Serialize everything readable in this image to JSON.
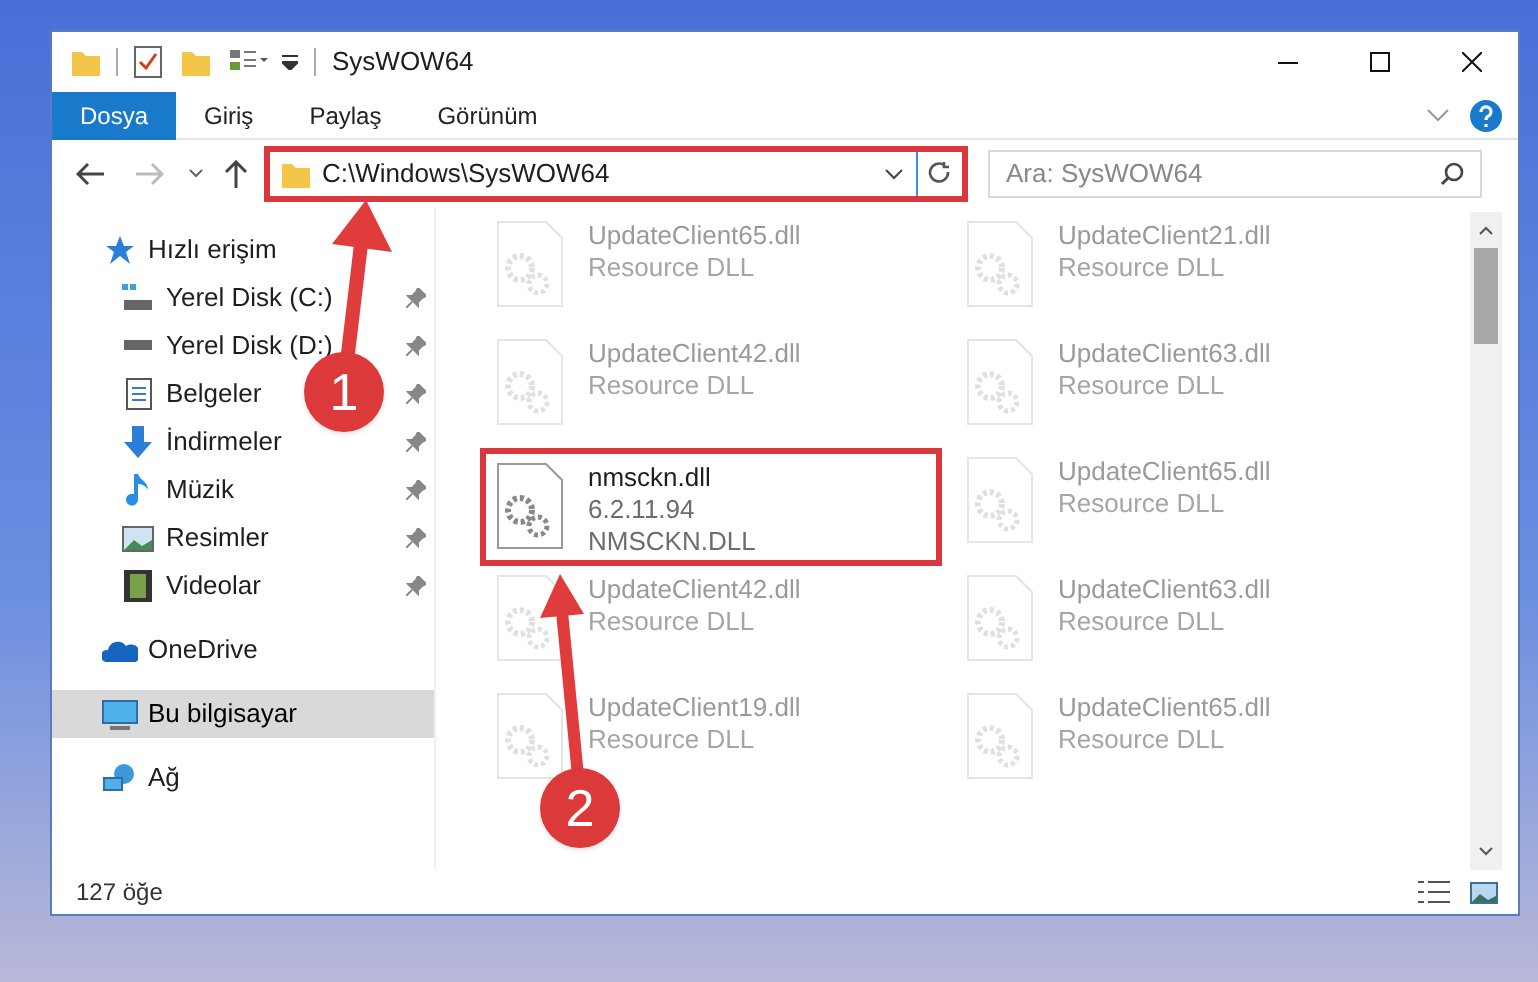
{
  "window": {
    "title": "SysWOW64"
  },
  "ribbon_tabs": [
    {
      "label": "Dosya",
      "selected": true
    },
    {
      "label": "Giriş",
      "selected": false
    },
    {
      "label": "Paylaş",
      "selected": false
    },
    {
      "label": "Görünüm",
      "selected": false
    }
  ],
  "address": {
    "path": "C:\\Windows\\SysWOW64",
    "highlighted": true
  },
  "search": {
    "placeholder": "Ara: SysWOW64"
  },
  "sidebar": {
    "items": [
      {
        "label": "Hızlı erişim",
        "kind": "star",
        "selected": false,
        "children": [
          {
            "label": "Yerel Disk (C:)",
            "kind": "system-drive",
            "pinned": true,
            "selected": false
          },
          {
            "label": "Yerel Disk (D:)",
            "kind": "drive",
            "pinned": true,
            "selected": false
          },
          {
            "label": "Belgeler",
            "kind": "document",
            "pinned": true,
            "selected": false
          },
          {
            "label": "İndirmeler",
            "kind": "download",
            "pinned": true,
            "selected": false
          },
          {
            "label": "Müzik",
            "kind": "music",
            "pinned": true,
            "selected": false
          },
          {
            "label": "Resimler",
            "kind": "pictures",
            "pinned": true,
            "selected": false
          },
          {
            "label": "Videolar",
            "kind": "videos",
            "pinned": true,
            "selected": false
          }
        ]
      },
      {
        "label": "OneDrive",
        "kind": "cloud",
        "selected": false
      },
      {
        "label": "Bu bilgisayar",
        "kind": "computer",
        "selected": true
      },
      {
        "label": "Ağ",
        "kind": "network",
        "selected": false
      }
    ]
  },
  "files": [
    {
      "name": "UpdateClient65.dll",
      "lines": [
        "Resource DLL"
      ],
      "faded": true,
      "highlighted": false
    },
    {
      "name": "UpdateClient21.dll",
      "lines": [
        "Resource DLL"
      ],
      "faded": true,
      "highlighted": false
    },
    {
      "name": "UpdateClient42.dll",
      "lines": [
        "Resource DLL"
      ],
      "faded": true,
      "highlighted": false
    },
    {
      "name": "UpdateClient63.dll",
      "lines": [
        "Resource DLL"
      ],
      "faded": true,
      "highlighted": false
    },
    {
      "name": "nmsckn.dll",
      "lines": [
        "6.2.11.94",
        "NMSCKN.DLL"
      ],
      "faded": false,
      "highlighted": true
    },
    {
      "name": "UpdateClient65.dll",
      "lines": [
        "Resource DLL"
      ],
      "faded": true,
      "highlighted": false
    },
    {
      "name": "UpdateClient42.dll",
      "lines": [
        "Resource DLL"
      ],
      "faded": true,
      "highlighted": false
    },
    {
      "name": "UpdateClient63.dll",
      "lines": [
        "Resource DLL"
      ],
      "faded": true,
      "highlighted": false
    },
    {
      "name": "UpdateClient19.dll",
      "lines": [
        "Resource DLL"
      ],
      "faded": true,
      "highlighted": false
    },
    {
      "name": "UpdateClient65.dll",
      "lines": [
        "Resource DLL"
      ],
      "faded": true,
      "highlighted": false
    }
  ],
  "annotations": [
    {
      "number": "1"
    },
    {
      "number": "2"
    }
  ],
  "status_bar": {
    "count": "127 öğe"
  }
}
